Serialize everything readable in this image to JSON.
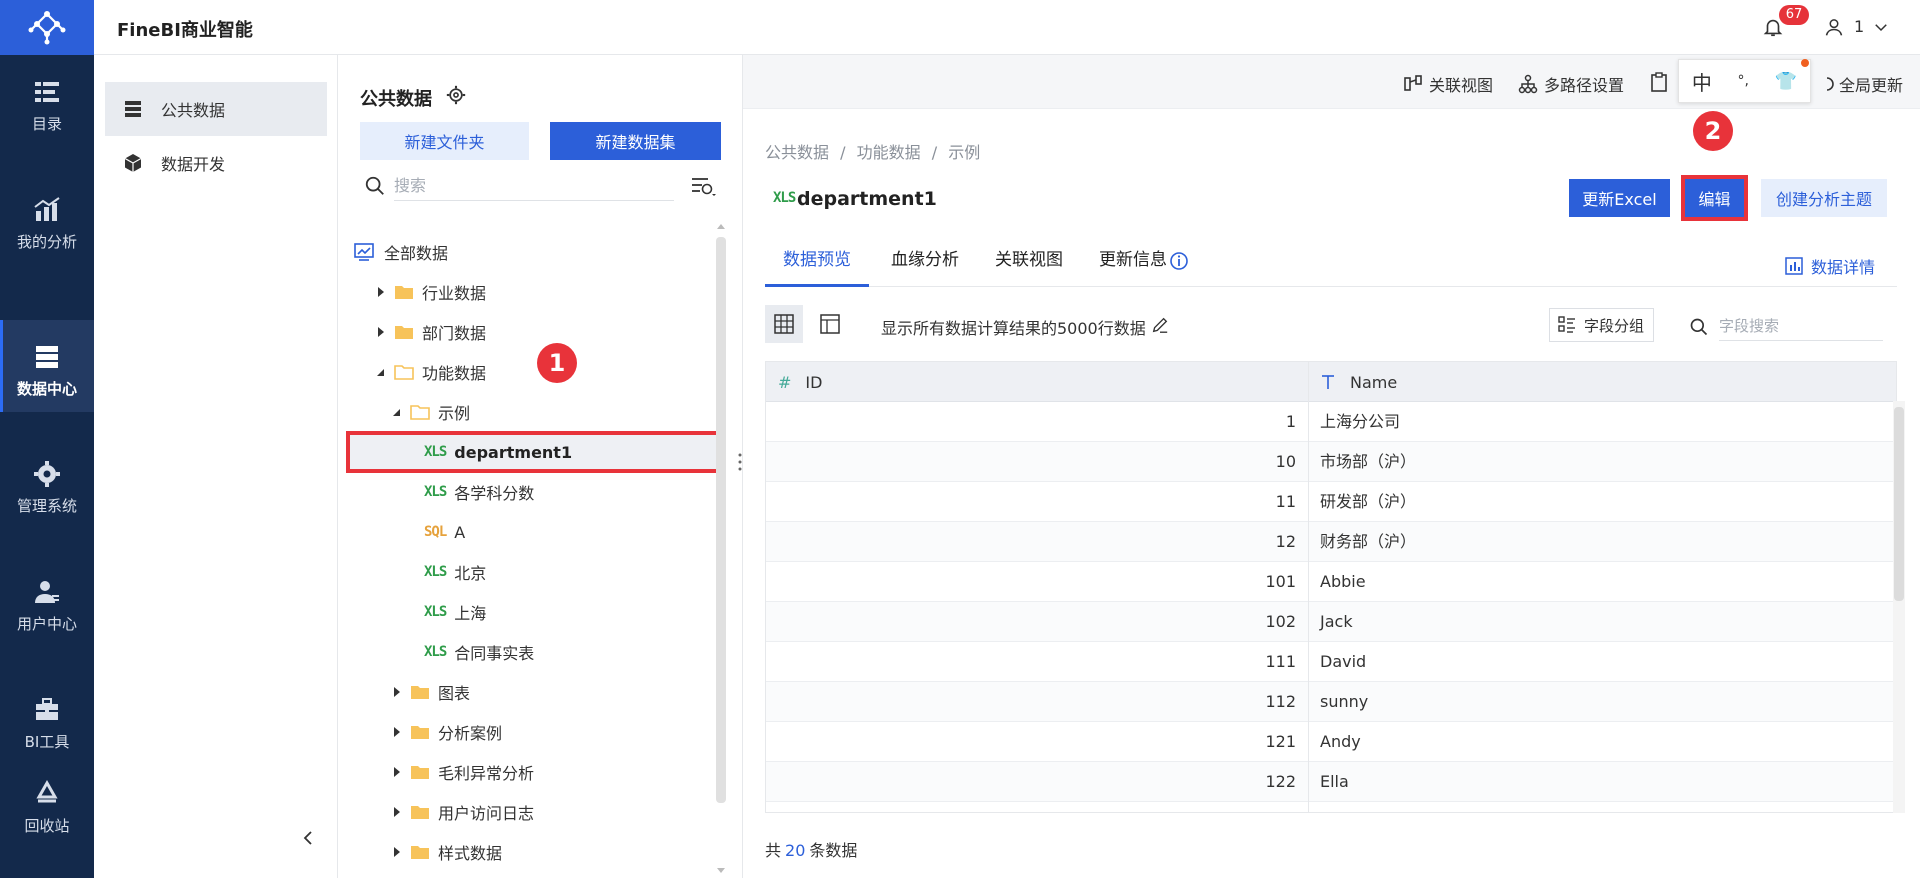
{
  "app": {
    "title": "FineBI商业智能"
  },
  "topbar": {
    "notification_count": "67",
    "user_name": "1"
  },
  "leftnav": {
    "items": [
      {
        "label": "目录"
      },
      {
        "label": "我的分析"
      },
      {
        "label": "数据中心"
      },
      {
        "label": "管理系统"
      },
      {
        "label": "用户中心"
      },
      {
        "label": "BI工具"
      },
      {
        "label": "回收站"
      }
    ],
    "active_index": 2
  },
  "sidebar2": {
    "items": [
      {
        "label": "公共数据"
      },
      {
        "label": "数据开发"
      }
    ]
  },
  "tree_panel": {
    "title": "公共数据",
    "new_folder_label": "新建文件夹",
    "new_dataset_label": "新建数据集",
    "search_placeholder": "搜索",
    "nodes": [
      {
        "label": "全部数据"
      },
      {
        "label": "行业数据"
      },
      {
        "label": "部门数据"
      },
      {
        "label": "功能数据"
      },
      {
        "label": "示例"
      },
      {
        "label": "department1",
        "type": "xls"
      },
      {
        "label": "各学科分数",
        "type": "xls"
      },
      {
        "label": "A",
        "type": "sql"
      },
      {
        "label": "北京",
        "type": "xls"
      },
      {
        "label": "上海",
        "type": "xls"
      },
      {
        "label": "合同事实表",
        "type": "xls"
      },
      {
        "label": "图表"
      },
      {
        "label": "分析案例"
      },
      {
        "label": "毛利异常分析"
      },
      {
        "label": "用户访问日志"
      },
      {
        "label": "样式数据"
      }
    ],
    "type_labels": {
      "xls": "XLS",
      "sql": "SQL"
    }
  },
  "steps": {
    "one": "1",
    "two": "2"
  },
  "toolbar": {
    "relation_view": "关联视图",
    "multipath": "多路径设置",
    "global_update": "全局更新",
    "ime": {
      "lang": "中",
      "punct": "°,",
      "skin": "👕"
    }
  },
  "main": {
    "breadcrumb": [
      "公共数据",
      "/",
      "功能数据",
      "/",
      "示例"
    ],
    "dataset_name": "department1",
    "update_excel_label": "更新Excel",
    "edit_label": "编辑",
    "create_theme_label": "创建分析主题",
    "tabs": [
      "数据预览",
      "血缘分析",
      "关联视图",
      "更新信息"
    ],
    "details_label": "数据详情",
    "preview_note": "显示所有数据计算结果的5000行数据",
    "field_group_label": "字段分组",
    "field_search_placeholder": "字段搜索",
    "columns": [
      {
        "label": "ID",
        "type_icon": "number"
      },
      {
        "label": "Name",
        "type_icon": "text"
      }
    ],
    "rows": [
      {
        "id": "1",
        "name": "上海分公司"
      },
      {
        "id": "10",
        "name": "市场部（沪）"
      },
      {
        "id": "11",
        "name": "研发部（沪）"
      },
      {
        "id": "12",
        "name": "财务部（沪）"
      },
      {
        "id": "101",
        "name": "Abbie"
      },
      {
        "id": "102",
        "name": "Jack"
      },
      {
        "id": "111",
        "name": "David"
      },
      {
        "id": "112",
        "name": "sunny"
      },
      {
        "id": "121",
        "name": "Andy"
      },
      {
        "id": "122",
        "name": "Ella"
      }
    ],
    "footer_prefix": "共",
    "footer_count": "20",
    "footer_suffix": "条数据"
  },
  "colors": {
    "brand": "#2c5fd9",
    "nav_bg": "#13294b",
    "highlight_red": "#e8333a"
  }
}
